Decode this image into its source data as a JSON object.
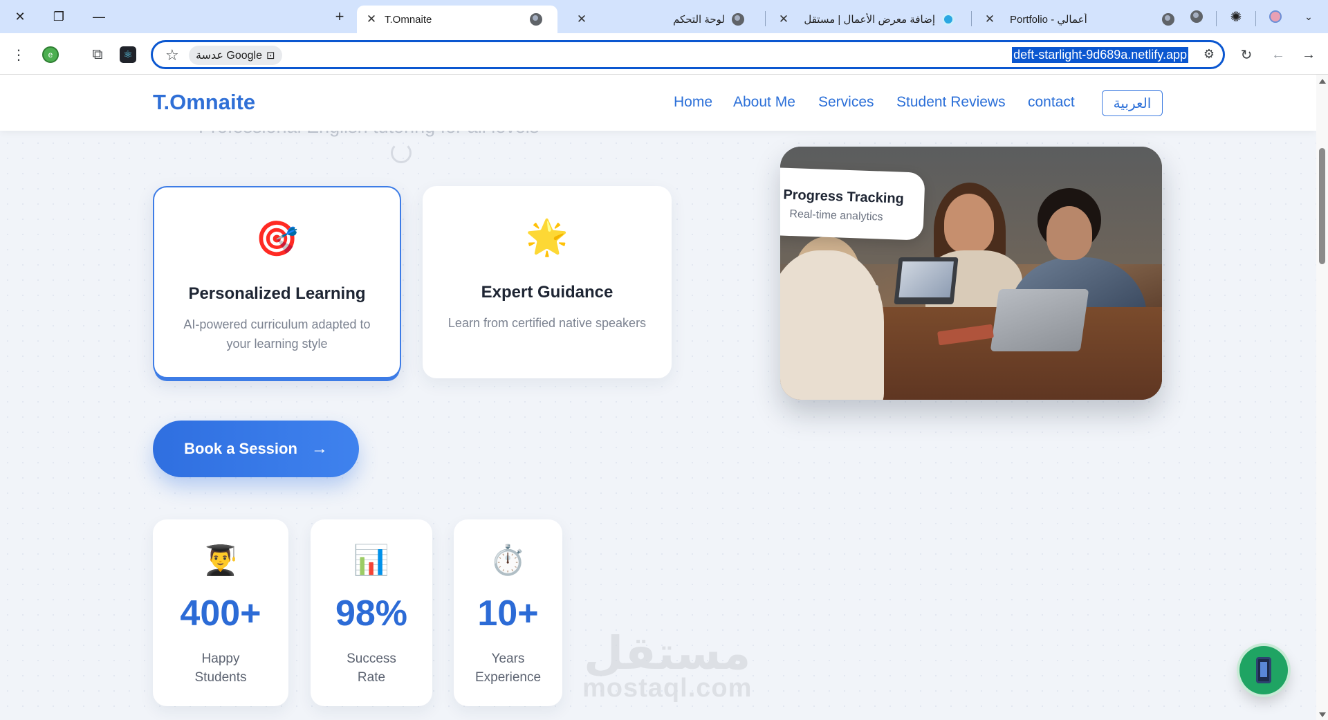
{
  "browser": {
    "tabs": [
      {
        "title": "T.Omnaite",
        "active": true
      },
      {
        "title": "لوحة التحكم",
        "active": false
      },
      {
        "title": "إضافة معرض الأعمال | مستقل",
        "active": false
      },
      {
        "title": "Portfolio - أعمالي",
        "active": false
      }
    ],
    "address_url": "deft-starlight-9d689a.netlify.app",
    "lens_chip_label": "عدسة Google",
    "extension_badge": "e"
  },
  "site": {
    "logo": "T.Omnaite",
    "nav": [
      "Home",
      "About Me",
      "Services",
      "Student Reviews",
      "contact"
    ],
    "language_button": "العربية",
    "hero_subtitle": "Professional English tutoring for all levels",
    "features": [
      {
        "icon": "🎯",
        "icon_name": "target-icon",
        "title": "Personalized Learning",
        "description": "AI-powered curriculum adapted to your learning style"
      },
      {
        "icon": "🌟",
        "icon_name": "star-icon",
        "title": "Expert Guidance",
        "description": "Learn from certified native speakers"
      }
    ],
    "photo_badge": {
      "title": "Progress Tracking",
      "subtitle": "Real-time analytics"
    },
    "cta_label": "Book a Session",
    "cta_arrow": "→",
    "stats": [
      {
        "icon": "👨‍🎓",
        "icon_name": "student-icon",
        "value": "400+",
        "label": "Happy Students"
      },
      {
        "icon": "📊",
        "icon_name": "bar-chart-icon",
        "value": "98%",
        "label": "Success Rate"
      },
      {
        "icon": "⏱️",
        "icon_name": "stopwatch-icon",
        "value": "10+",
        "label": "Years Experience"
      }
    ],
    "watermark": {
      "arabic": "مستقل",
      "latin": "mostaql.com"
    }
  },
  "colors": {
    "accent": "#2f6fd6",
    "fab": "#1fa463",
    "tabbar": "#d3e3fd"
  }
}
